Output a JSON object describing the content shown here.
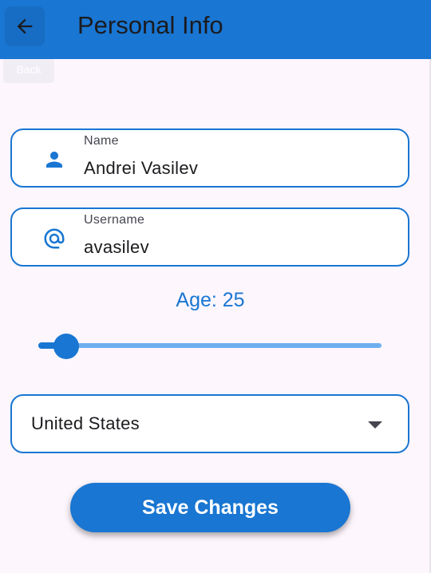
{
  "app_bar": {
    "title": "Personal Info",
    "back_icon": "arrow-left-icon",
    "back_tooltip": "Back",
    "background_color": "#1976d2"
  },
  "form": {
    "name_field": {
      "label": "Name",
      "value": "Andrei Vasilev",
      "icon": "person-icon"
    },
    "username_field": {
      "label": "Username",
      "value": "avasilev",
      "icon": "at-sign-icon"
    },
    "age": {
      "label": "Age: 25",
      "value": 25,
      "fraction": 0.06
    },
    "country": {
      "selected": "United States",
      "icon": "dropdown-caret-icon"
    },
    "save_label": "Save Changes"
  },
  "colors": {
    "accent": "#1976d2",
    "slider_track": "#6cb0f0",
    "background": "#fdf6fd"
  }
}
